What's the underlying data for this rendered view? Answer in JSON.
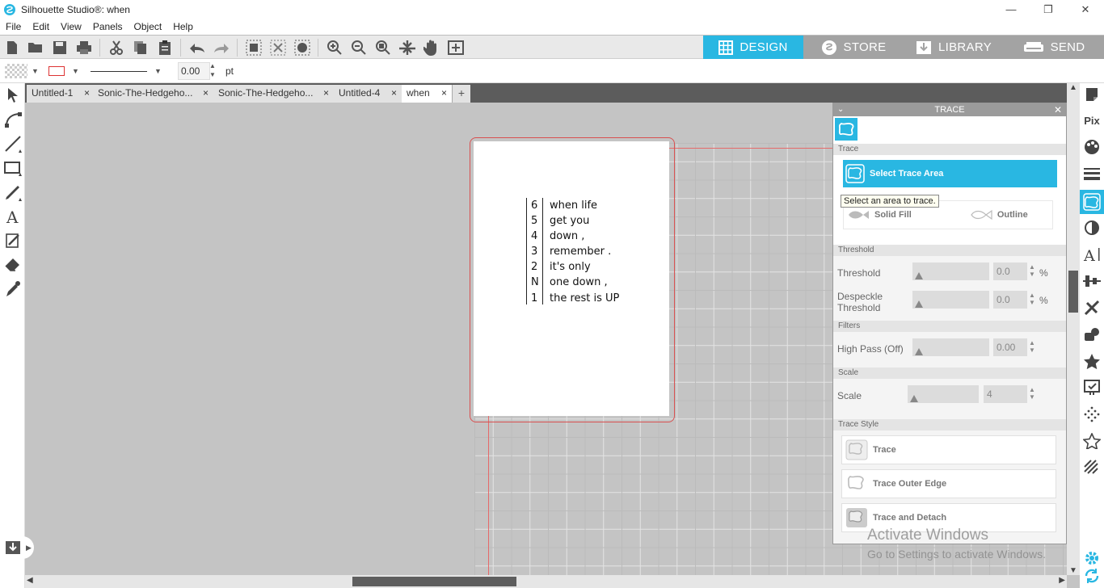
{
  "window": {
    "title": "Silhouette Studio®: when",
    "min": "—",
    "restore": "❐",
    "close": "✕"
  },
  "menu": [
    "File",
    "Edit",
    "View",
    "Panels",
    "Object",
    "Help"
  ],
  "modes": {
    "design": "DESIGN",
    "store": "STORE",
    "library": "LIBRARY",
    "send": "SEND",
    "active": "design",
    "accent": "#29b7e2"
  },
  "style_bar": {
    "line_width": "0.00",
    "unit": "pt"
  },
  "tabs": [
    {
      "label": "Untitled-1",
      "close": "×"
    },
    {
      "label": "Sonic-The-Hedgeho...",
      "close": "×"
    },
    {
      "label": "Sonic-The-Hedgeho...",
      "close": "×"
    },
    {
      "label": "Untitled-4",
      "close": "×"
    },
    {
      "label": "when",
      "close": "×",
      "active": true
    }
  ],
  "add_tab": "+",
  "design_text": {
    "numbers": [
      "6",
      "5",
      "4",
      "3",
      "2",
      "N",
      "1"
    ],
    "lines": [
      "when life",
      "get you",
      "down ,",
      "remember .",
      "it's only",
      "one down ,",
      "the rest is UP"
    ]
  },
  "trace": {
    "title": "TRACE",
    "chevron": "⌄",
    "close": "✕",
    "section_trace": "Trace",
    "select_area_btn": "Select Trace Area",
    "tooltip": "Select an area to trace.",
    "solid_fill": "Solid Fill",
    "outline": "Outline",
    "section_threshold": "Threshold",
    "threshold_label": "Threshold",
    "threshold_value": "0.0",
    "despeckle_label": "Despeckle Threshold",
    "despeckle_value": "0.0",
    "pct": "%",
    "section_filters": "Filters",
    "highpass_label": "High Pass (Off)",
    "highpass_value": "0.00",
    "section_scale": "Scale",
    "scale_label": "Scale",
    "scale_value": "4",
    "section_style": "Trace Style",
    "style_trace": "Trace",
    "style_outer": "Trace Outer Edge",
    "style_detach": "Trace and Detach"
  },
  "right_tools_pix": "Pix",
  "watermark": {
    "line1": "Activate Windows",
    "line2": "Go to Settings to activate Windows."
  }
}
